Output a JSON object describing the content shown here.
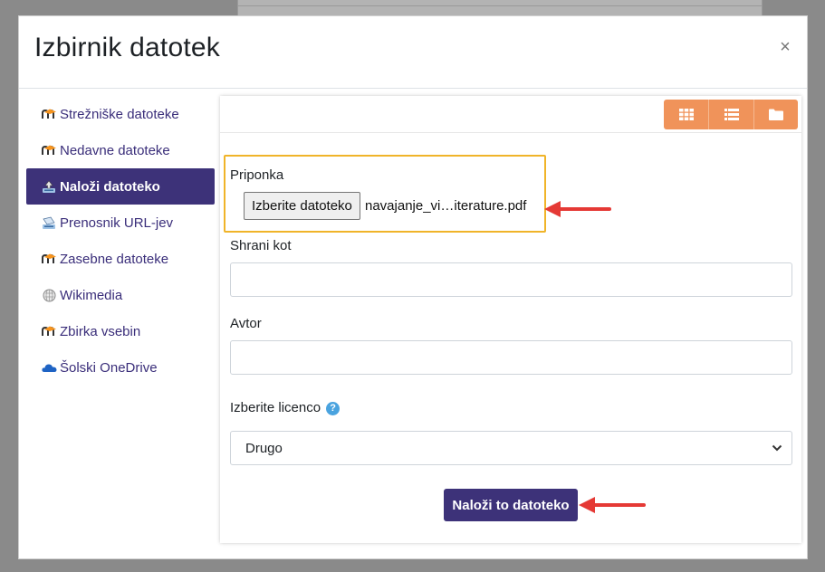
{
  "dialog": {
    "title": "Izbirnik datotek",
    "close_symbol": "×"
  },
  "sidebar": {
    "items": [
      {
        "label": "Strežniške datoteke",
        "icon": "moodle-icon",
        "active": false
      },
      {
        "label": "Nedavne datoteke",
        "icon": "moodle-icon",
        "active": false
      },
      {
        "label": "Naloži datoteko",
        "icon": "upload-icon",
        "active": true
      },
      {
        "label": "Prenosnik URL-jev",
        "icon": "url-download-icon",
        "active": false
      },
      {
        "label": "Zasebne datoteke",
        "icon": "moodle-icon",
        "active": false
      },
      {
        "label": "Wikimedia",
        "icon": "wikimedia-globe-icon",
        "active": false
      },
      {
        "label": "Zbirka vsebin",
        "icon": "moodle-icon",
        "active": false
      },
      {
        "label": "Šolski OneDrive",
        "icon": "onedrive-cloud-icon",
        "active": false
      }
    ]
  },
  "toolbar": {
    "views": [
      "grid-view-icon",
      "list-view-icon",
      "folder-view-icon"
    ],
    "accent": "#f0935a"
  },
  "form": {
    "attachment_label": "Priponka",
    "choose_file_label": "Izberite datoteko",
    "file_name": "navajanje_vi…iterature.pdf",
    "save_as_label": "Shrani kot",
    "save_as_value": "",
    "author_label": "Avtor",
    "author_value": "",
    "license_label": "Izberite licenco",
    "license_selected": "Drugo",
    "upload_label": "Naloži to datoteko"
  },
  "colors": {
    "primary": "#3d3279",
    "highlight": "#f0b429",
    "annotation_arrow": "#e53935",
    "help": "#4aa3df"
  }
}
